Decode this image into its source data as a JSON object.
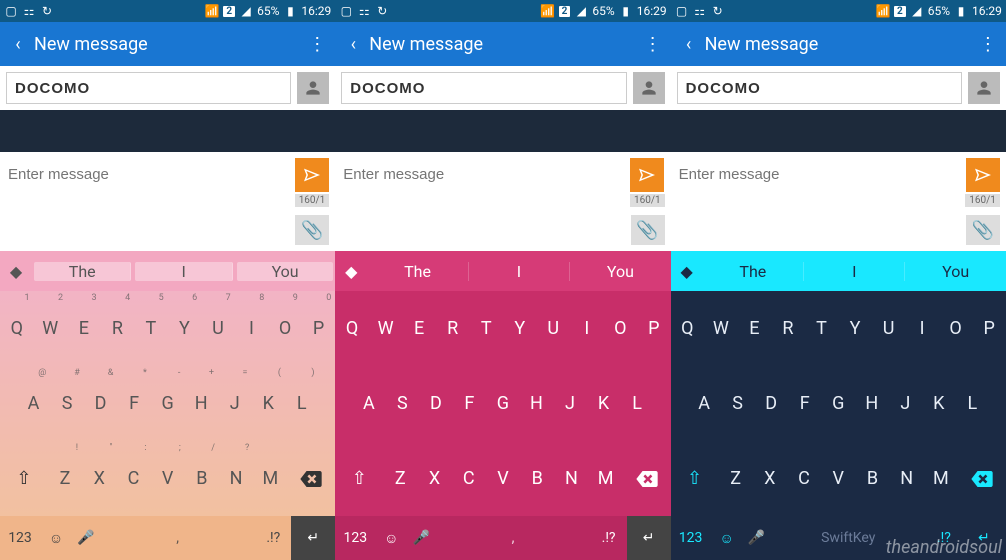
{
  "status": {
    "battery": "65%",
    "time": "16:29",
    "sim": "2",
    "icons": [
      "gallery",
      "voicemail",
      "phone-forward",
      "wifi",
      "signal",
      "battery"
    ]
  },
  "appbar": {
    "title": "New message",
    "back": "‹",
    "menu": "⋮"
  },
  "recipient": {
    "value": "DOCOMO"
  },
  "compose": {
    "placeholder": "Enter message",
    "counter": "160/1"
  },
  "suggestions": [
    "The",
    "I",
    "You"
  ],
  "rows": {
    "r1": [
      "Q",
      "W",
      "E",
      "R",
      "T",
      "Y",
      "U",
      "I",
      "O",
      "P"
    ],
    "r1sec": [
      "1",
      "2",
      "3",
      "4",
      "5",
      "6",
      "7",
      "8",
      "9",
      "0"
    ],
    "r2": [
      "A",
      "S",
      "D",
      "F",
      "G",
      "H",
      "J",
      "K",
      "L"
    ],
    "r2sec": [
      "@",
      "#",
      "&",
      "*",
      "-",
      "+",
      "=",
      "(",
      ")"
    ],
    "r3": [
      "Z",
      "X",
      "C",
      "V",
      "B",
      "N",
      "M"
    ],
    "r3sec": [
      "!",
      "\"",
      ":",
      ";",
      "/",
      "?",
      ""
    ]
  },
  "bottom": {
    "num": "123",
    "space_left": ",",
    "space_right": ".!?"
  },
  "swiftkey_label": "SwiftKey",
  "watermark": "theandroidsoul"
}
